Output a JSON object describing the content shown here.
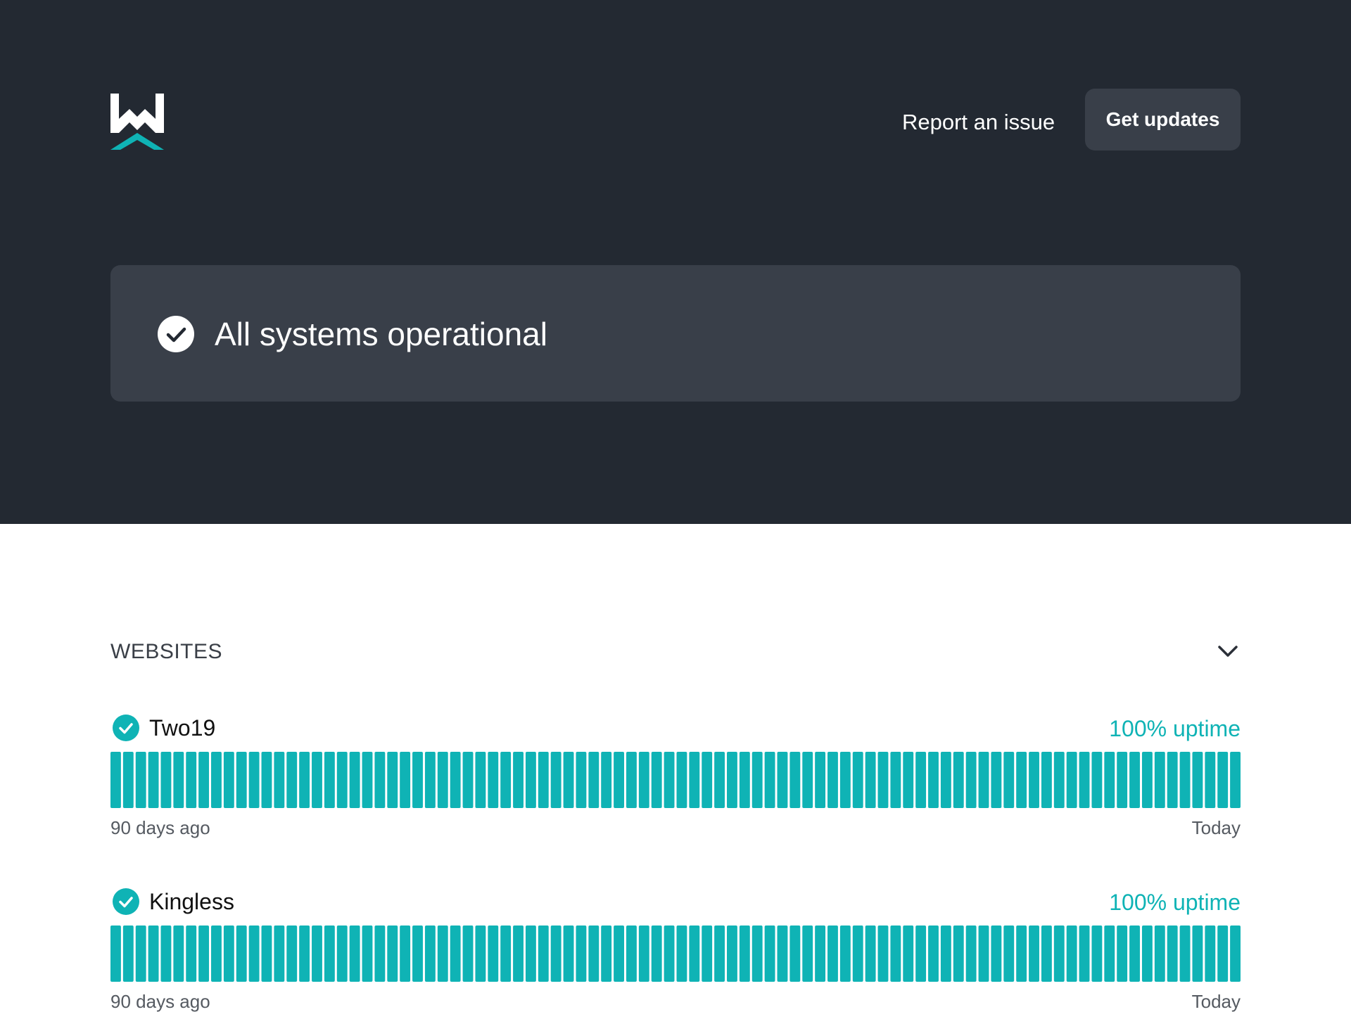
{
  "header": {
    "logo_icon": "workspace-logo-icon",
    "report_link": "Report an issue",
    "updates_button": "Get updates"
  },
  "status": {
    "icon": "check-circle-icon",
    "text": "All systems operational"
  },
  "colors": {
    "hero_bg": "#232932",
    "card_bg": "#393f49",
    "accent": "#0fb3b5"
  },
  "group": {
    "title": "WEBSITES",
    "toggle_icon": "chevron-down-icon",
    "components": [
      {
        "name": "Two19",
        "uptime": "100% uptime",
        "range_start": "90 days ago",
        "range_end": "Today",
        "status_icon": "check-circle-icon",
        "days": 90
      },
      {
        "name": "Kingless",
        "uptime": "100% uptime",
        "range_start": "90 days ago",
        "range_end": "Today",
        "status_icon": "check-circle-icon",
        "days": 90
      }
    ]
  }
}
